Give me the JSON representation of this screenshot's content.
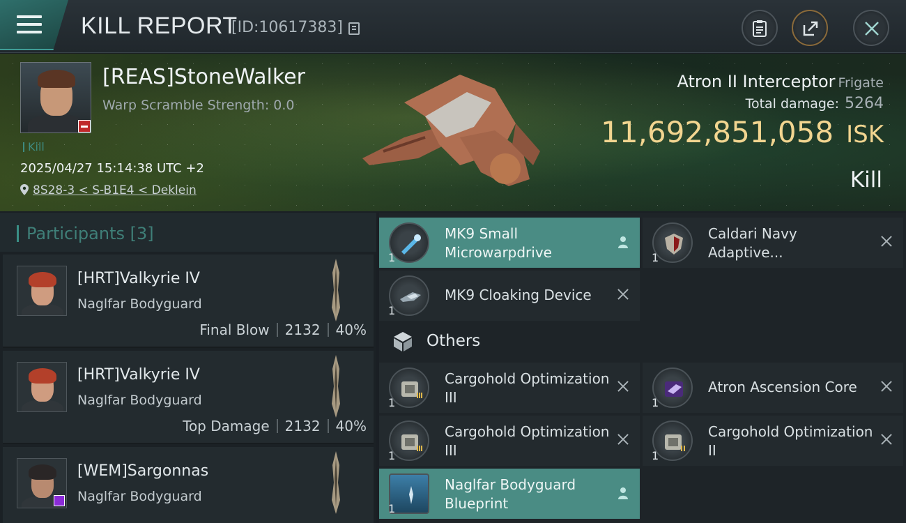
{
  "header": {
    "title": "KILL REPORT",
    "report_id": "[ID:10617383]"
  },
  "victim": {
    "name": "[REAS]StoneWalker",
    "warp_scramble": "Warp Scramble Strength: 0.0",
    "tag": "Kill",
    "datetime": "2025/04/27 15:14:38 UTC +2",
    "location": "8S28-3 < S-B1E4 < Deklein",
    "ship_name": "Atron II Interceptor",
    "ship_class": "Frigate",
    "damage_label": "Total damage:",
    "damage_value": "5264",
    "isk_value": "11,692,851,058",
    "isk_unit": "ISK",
    "result": "Kill"
  },
  "participants": {
    "title": "Participants",
    "count": "[3]",
    "rows": [
      {
        "name": "[HRT]Valkyrie IV",
        "ship": "Naglfar Bodyguard",
        "role": "Final Blow",
        "damage": "2132",
        "percent": "40%"
      },
      {
        "name": "[HRT]Valkyrie IV",
        "ship": "Naglfar Bodyguard",
        "role": "Top Damage",
        "damage": "2132",
        "percent": "40%"
      },
      {
        "name": "[WEM]Sargonnas",
        "ship": "Naglfar Bodyguard"
      }
    ]
  },
  "items": {
    "fitted": [
      {
        "label": "MK9 Small Microwarpdrive",
        "qty": "1",
        "icon": "microwarpdrive-icon",
        "status": "dropped"
      },
      {
        "label": "Caldari Navy Adaptive...",
        "qty": "1",
        "icon": "shield-hardener-icon",
        "status": "destroyed"
      },
      {
        "label": "MK9 Cloaking Device",
        "qty": "1",
        "icon": "cloaking-device-icon",
        "status": "destroyed"
      }
    ],
    "others_label": "Others",
    "others": [
      {
        "label": "Cargohold Optimization III",
        "qty": "1",
        "icon": "rig-icon",
        "status": "destroyed"
      },
      {
        "label": "Atron Ascension Core",
        "qty": "1",
        "icon": "core-icon",
        "status": "destroyed"
      },
      {
        "label": "Cargohold Optimization III",
        "qty": "1",
        "icon": "rig-icon",
        "status": "destroyed"
      },
      {
        "label": "Cargohold Optimization II",
        "qty": "1",
        "icon": "rig-icon",
        "status": "destroyed"
      },
      {
        "label": "Naglfar Bodyguard Blueprint",
        "qty": "1",
        "icon": "blueprint-icon",
        "status": "dropped"
      }
    ]
  },
  "colors": {
    "accent_teal": "#4a8c84",
    "isk_gold": "#f2d590",
    "victim_badge_red": "#c0282a"
  }
}
